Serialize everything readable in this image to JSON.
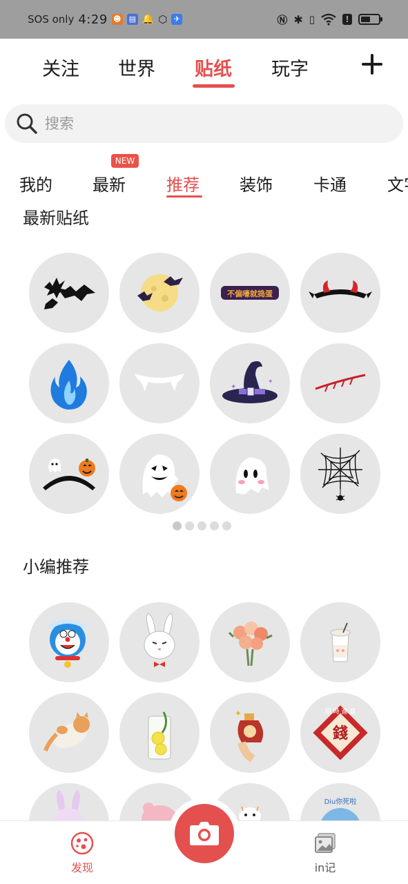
{
  "status_bar": {
    "carrier": "SOS only",
    "time": "4:29",
    "battery_level": 0.55
  },
  "top_tabs": [
    {
      "label": "关注"
    },
    {
      "label": "世界"
    },
    {
      "label": "贴纸",
      "active": true
    },
    {
      "label": "玩字"
    }
  ],
  "search": {
    "placeholder": "搜索",
    "value": ""
  },
  "category_tabs": {
    "new_badge": "NEW",
    "items": [
      {
        "label": "我的"
      },
      {
        "label": "最新"
      },
      {
        "label": "推荐",
        "active": true
      },
      {
        "label": "装饰"
      },
      {
        "label": "卡通"
      },
      {
        "label": "文字"
      }
    ]
  },
  "latest_section": {
    "title": "最新贴纸",
    "page_index": 1,
    "page_count": 5,
    "stickers": [
      {
        "name": "bats"
      },
      {
        "name": "moon-bats"
      },
      {
        "name": "text-sticker",
        "text": "不偏嚎就捣蛋"
      },
      {
        "name": "devil-horns"
      },
      {
        "name": "blue-flame"
      },
      {
        "name": "vampire-fangs"
      },
      {
        "name": "witch-hat"
      },
      {
        "name": "scratch-wound"
      },
      {
        "name": "ghost-pumpkin-headband"
      },
      {
        "name": "ghost-pumpkin"
      },
      {
        "name": "cute-ghost"
      },
      {
        "name": "spider-web"
      }
    ]
  },
  "editor_section": {
    "title": "小编推荐",
    "stickers": [
      {
        "name": "doraemon-winter"
      },
      {
        "name": "white-rabbit"
      },
      {
        "name": "flower-bouquet"
      },
      {
        "name": "milk-tea"
      },
      {
        "name": "lying-cat"
      },
      {
        "name": "lemon-water"
      },
      {
        "name": "lucky-bottle"
      },
      {
        "name": "money-fortune",
        "text": "招 時 進 寶"
      },
      {
        "name": "pink-rabbit"
      },
      {
        "name": "pink-pig"
      },
      {
        "name": "bear-face"
      },
      {
        "name": "blue-avatar",
        "text": "Diu你死啦"
      }
    ]
  },
  "bottom_nav": {
    "discover_label": "发现",
    "record_label": "in记"
  },
  "colors": {
    "accent": "#e4504e",
    "sticker_bg": "#e6e6e6",
    "status_bar": "#9e9e9e"
  }
}
